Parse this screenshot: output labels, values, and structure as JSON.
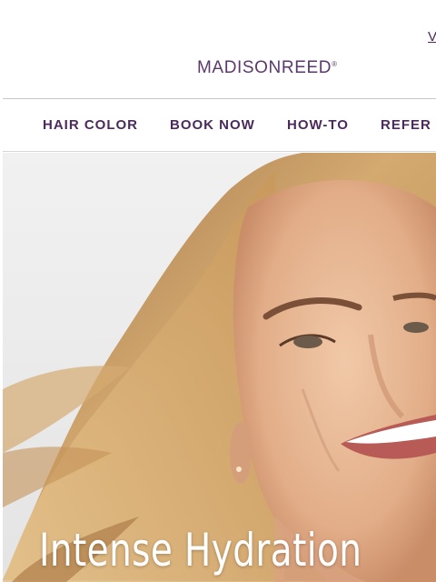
{
  "header": {
    "top_link": "V",
    "logo": {
      "part1": "MADISON",
      "part2": "REED",
      "mark": "®"
    }
  },
  "nav": {
    "items": [
      {
        "label": "HAIR COLOR"
      },
      {
        "label": "BOOK NOW"
      },
      {
        "label": "HOW-TO"
      },
      {
        "label": "REFER"
      }
    ]
  },
  "hero": {
    "title": "Intense Hydration",
    "image": "smiling-woman-blonde-hair-photo"
  },
  "colors": {
    "brand_purple": "#4b2a5c",
    "hero_background": "#ececec",
    "hero_text": "#ffffff"
  }
}
